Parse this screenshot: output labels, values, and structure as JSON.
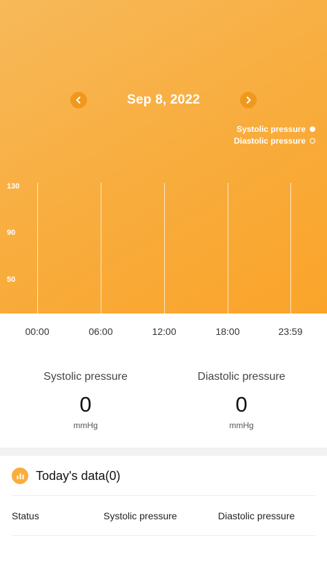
{
  "header": {
    "date": "Sep 8, 2022",
    "prev_icon": "chevron-left-icon",
    "next_icon": "chevron-right-icon"
  },
  "legend": {
    "systolic": "Systolic pressure",
    "diastolic": "Diastolic pressure"
  },
  "chart": {
    "y_ticks": [
      "130",
      "90",
      "50"
    ],
    "x_ticks": [
      "00:00",
      "06:00",
      "12:00",
      "18:00",
      "23:59"
    ]
  },
  "stats": {
    "systolic": {
      "label": "Systolic pressure",
      "value": "0",
      "unit": "mmHg"
    },
    "diastolic": {
      "label": "Diastolic pressure",
      "value": "0",
      "unit": "mmHg"
    }
  },
  "today": {
    "title": "Today's data(0)",
    "icon": "bar-chart-icon",
    "columns": [
      "Status",
      "Systolic pressure",
      "Diastolic pressure"
    ]
  },
  "colors": {
    "accent": "#f9ad3b",
    "nav_button": "#f0981d"
  }
}
